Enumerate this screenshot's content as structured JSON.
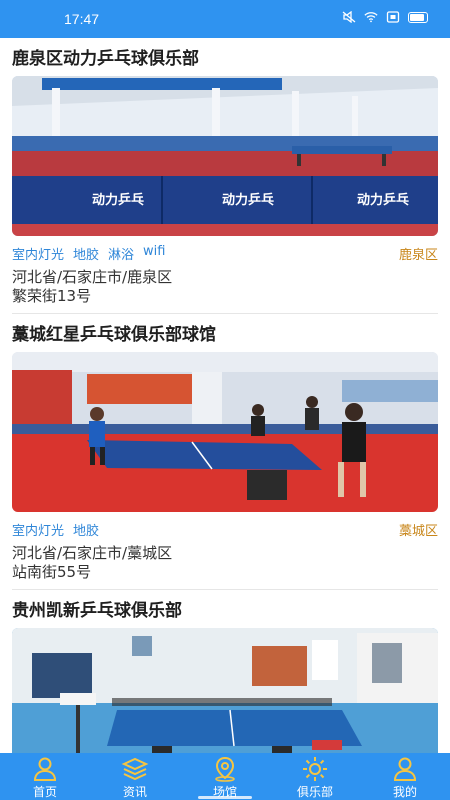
{
  "status_bar": {
    "time": "17:47"
  },
  "venues": [
    {
      "title": "鹿泉区动力乒乓球俱乐部",
      "tags": [
        "室内灯光",
        "地胶",
        "淋浴",
        "wifi"
      ],
      "district": "鹿泉区",
      "address_line1": "河北省/石家庄市/鹿泉区",
      "address_line2": "繁荣街13号",
      "photo_icon": "gym-photo",
      "banner_text": "动力乒乓"
    },
    {
      "title": "藁城红星乒乓球俱乐部球馆",
      "tags": [
        "室内灯光",
        "地胶"
      ],
      "district": "藁城区",
      "address_line1": "河北省/石家庄市/藁城区",
      "address_line2": "站南街55号",
      "photo_icon": "gym-photo"
    },
    {
      "title": "贵州凯新乒乓球俱乐部",
      "photo_icon": "gym-photo"
    }
  ],
  "nav": {
    "items": [
      {
        "label": "首页",
        "icon": "home-icon"
      },
      {
        "label": "资讯",
        "icon": "news-icon"
      },
      {
        "label": "场馆",
        "icon": "venue-icon"
      },
      {
        "label": "俱乐部",
        "icon": "club-icon"
      },
      {
        "label": "我的",
        "icon": "profile-icon"
      }
    ],
    "active_index": 2
  },
  "colors": {
    "primary": "#2f93f0",
    "tag": "#2f86d8",
    "district": "#c8861a",
    "nav_icon": "#f5c542"
  }
}
